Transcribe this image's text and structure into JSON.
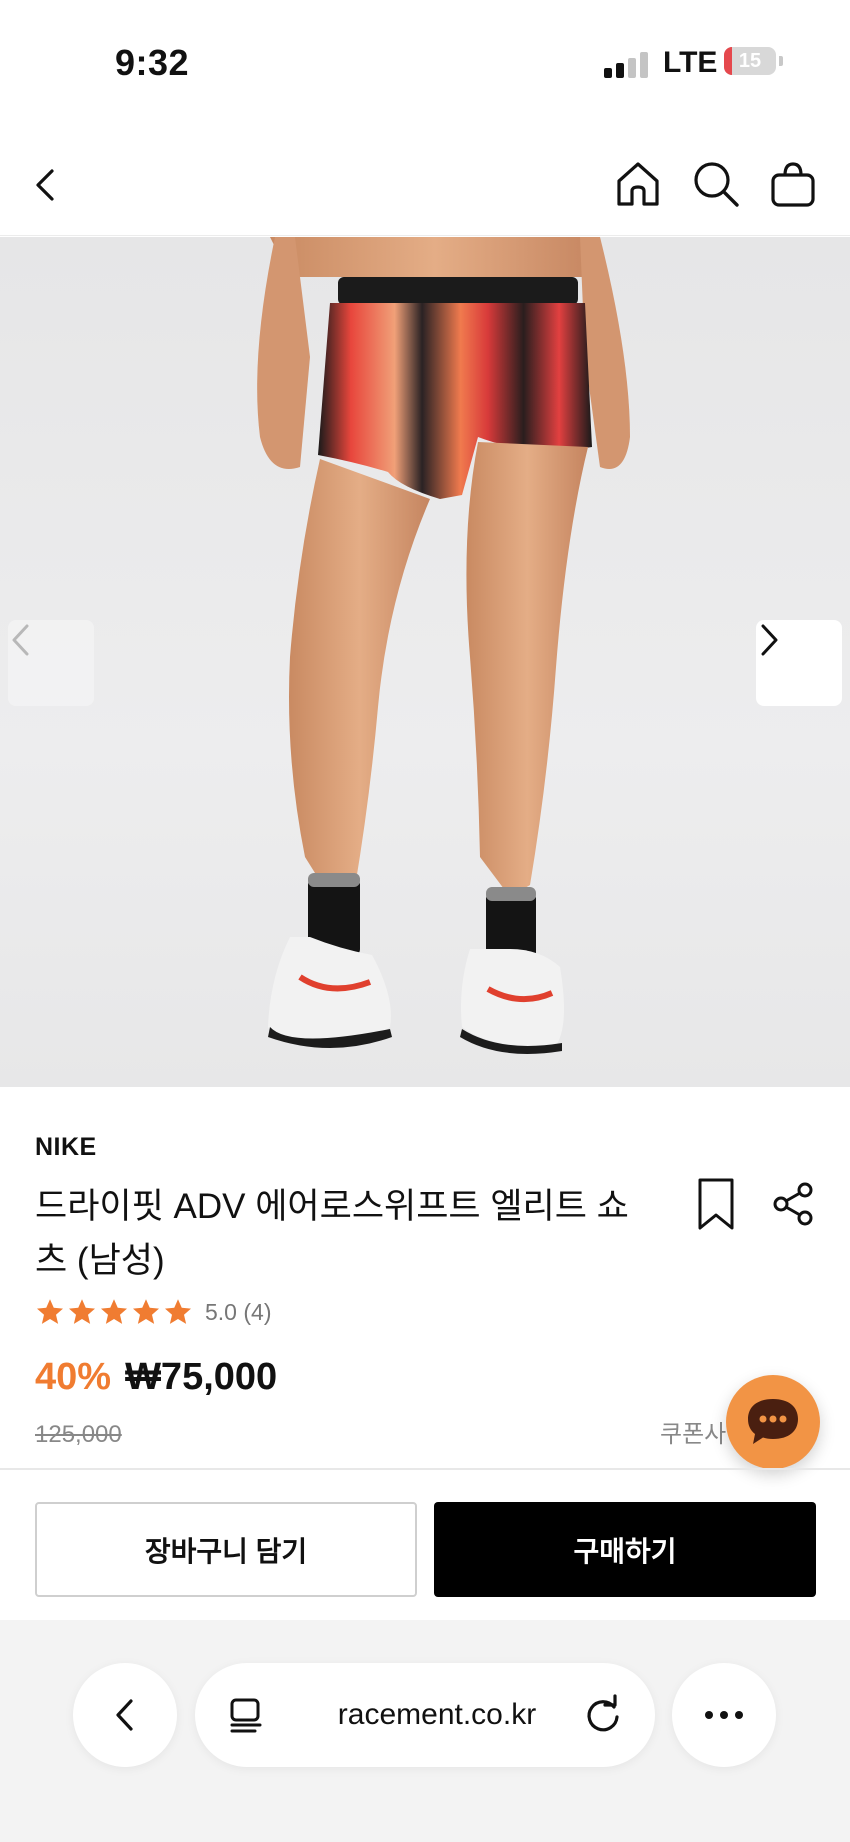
{
  "status_bar": {
    "time": "9:32",
    "network": "LTE",
    "battery": "15",
    "battery_level": 0.15,
    "battery_color": "#e5484d"
  },
  "header": {
    "icons": [
      "back-icon",
      "home-icon",
      "search-icon",
      "shopping-bag-icon"
    ]
  },
  "carousel": {
    "image": "product-photo",
    "prev_icon": "chevron-left-icon",
    "next_icon": "chevron-right-icon"
  },
  "product": {
    "brand": "NIKE",
    "title": "드라이핏 ADV 에어로스위프트 엘리트 쇼츠 (남성)",
    "rating_stars": 5,
    "rating_text": "5.0 (4)",
    "discount": "40%",
    "price": "₩75,000",
    "original_price": "125,000",
    "coupon_text": "쿠폰사"
  },
  "actions": {
    "cart_label": "장바구니 담기",
    "buy_label": "구매하기"
  },
  "browser": {
    "url": "racement.co.kr"
  },
  "colors": {
    "accent": "#f07c31",
    "chat_button": "#f29445",
    "star": "#f07c31",
    "buy_button": "#000000"
  }
}
